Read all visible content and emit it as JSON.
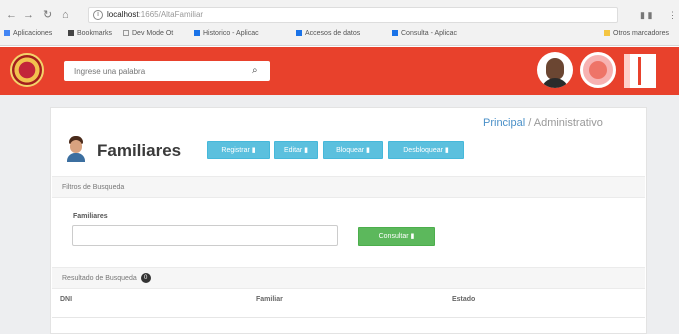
{
  "browser": {
    "nav": [
      "←",
      "→",
      "↻",
      "⌂"
    ],
    "url_host": "localhost",
    "url_path": ":1665/AltaFamiliar",
    "bookmarks": [
      {
        "label": "Aplicaciones",
        "color": "#4285f4"
      },
      {
        "label": "Bookmarks",
        "color": "#444444"
      },
      {
        "label": "Dev Mode Ot",
        "color": "#999999"
      },
      {
        "label": "Historico - Aplicac",
        "color": "#1a73e8"
      },
      {
        "label": "Accesos de datos",
        "color": "#1a73e8"
      },
      {
        "label": "Consulta - Aplicac",
        "color": "#1a73e8"
      }
    ],
    "other_bookmarks": "Otros marcadores"
  },
  "header": {
    "search_placeholder": "Ingrese una palabra",
    "search_icon": "search-icon",
    "accent": "#e8412c"
  },
  "breadcrumb": {
    "link": "Principal",
    "separator": " / ",
    "current": "Administrativo"
  },
  "title": "Familiares",
  "actions": [
    {
      "label": "Registrar ▮",
      "color": "#5bc0de"
    },
    {
      "label": "Editar ▮",
      "color": "#5bc0de"
    },
    {
      "label": "Bloquear ▮",
      "color": "#5bc0de"
    },
    {
      "label": "Desbloquear ▮",
      "color": "#5bc0de"
    }
  ],
  "filter": {
    "section_title": "Filtros de Busqueda",
    "field_label": "Familiares",
    "field_value": "",
    "consult_label": "Consultar ▮",
    "consult_color": "#5cb85c"
  },
  "results": {
    "section_title": "Resultado de Busqueda",
    "count": "0",
    "columns": [
      "DNI",
      "Familiar",
      "Estado"
    ]
  }
}
